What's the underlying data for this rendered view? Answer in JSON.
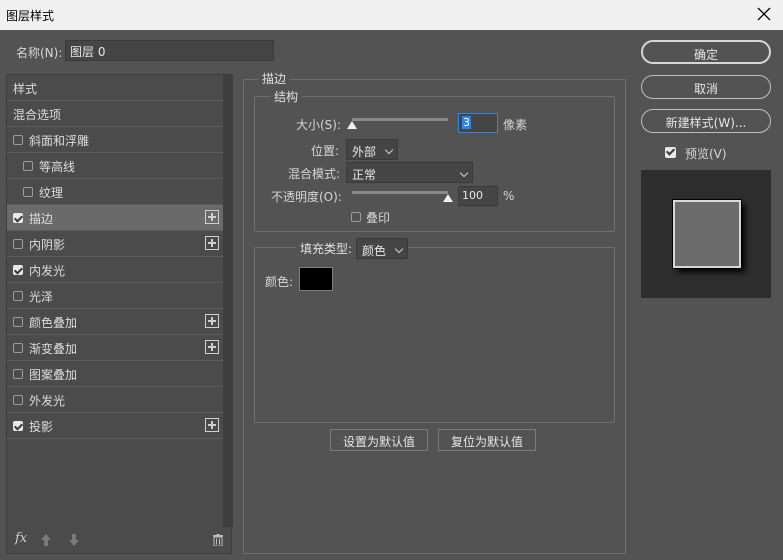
{
  "window": {
    "title": "图层样式"
  },
  "name_field": {
    "label": "名称(N):",
    "value": "图层 0"
  },
  "styles_list": [
    {
      "label": "样式",
      "checkbox": false,
      "checked": false,
      "plus": false,
      "indent": 0,
      "selected": false
    },
    {
      "label": "混合选项",
      "checkbox": false,
      "checked": false,
      "plus": false,
      "indent": 0,
      "selected": false
    },
    {
      "label": "斜面和浮雕",
      "checkbox": true,
      "checked": false,
      "plus": false,
      "indent": 0,
      "selected": false
    },
    {
      "label": "等高线",
      "checkbox": true,
      "checked": false,
      "plus": false,
      "indent": 1,
      "selected": false
    },
    {
      "label": "纹理",
      "checkbox": true,
      "checked": false,
      "plus": false,
      "indent": 1,
      "selected": false
    },
    {
      "label": "描边",
      "checkbox": true,
      "checked": true,
      "plus": true,
      "indent": 0,
      "selected": true
    },
    {
      "label": "内阴影",
      "checkbox": true,
      "checked": false,
      "plus": true,
      "indent": 0,
      "selected": false
    },
    {
      "label": "内发光",
      "checkbox": true,
      "checked": true,
      "plus": false,
      "indent": 0,
      "selected": false
    },
    {
      "label": "光泽",
      "checkbox": true,
      "checked": false,
      "plus": false,
      "indent": 0,
      "selected": false
    },
    {
      "label": "颜色叠加",
      "checkbox": true,
      "checked": false,
      "plus": true,
      "indent": 0,
      "selected": false
    },
    {
      "label": "渐变叠加",
      "checkbox": true,
      "checked": false,
      "plus": true,
      "indent": 0,
      "selected": false
    },
    {
      "label": "图案叠加",
      "checkbox": true,
      "checked": false,
      "plus": false,
      "indent": 0,
      "selected": false
    },
    {
      "label": "外发光",
      "checkbox": true,
      "checked": false,
      "plus": false,
      "indent": 0,
      "selected": false
    },
    {
      "label": "投影",
      "checkbox": true,
      "checked": true,
      "plus": true,
      "indent": 0,
      "selected": false
    }
  ],
  "bottom_toolbar": {
    "fx_label": "fx"
  },
  "stroke": {
    "section_title": "描边",
    "structure_title": "结构",
    "size_label": "大小(S):",
    "size_value": "3",
    "size_fraction": 0.0,
    "size_unit": "像素",
    "position_label": "位置:",
    "position_value": "外部",
    "blend_label": "混合模式:",
    "blend_value": "正常",
    "opacity_label": "不透明度(O):",
    "opacity_value": "100",
    "opacity_fraction": 1.0,
    "opacity_unit": "%",
    "overprint_label": "叠印",
    "overprint_checked": false,
    "fill_type_label": "填充类型:",
    "fill_type_value": "颜色",
    "color_label": "颜色:",
    "color_value": "#000000",
    "make_default_label": "设置为默认值",
    "reset_default_label": "复位为默认值"
  },
  "right_buttons": {
    "ok_label": "确定",
    "cancel_label": "取消",
    "new_style_label": "新建样式(W)...",
    "preview_label": "预览(V)",
    "preview_checked": true
  }
}
